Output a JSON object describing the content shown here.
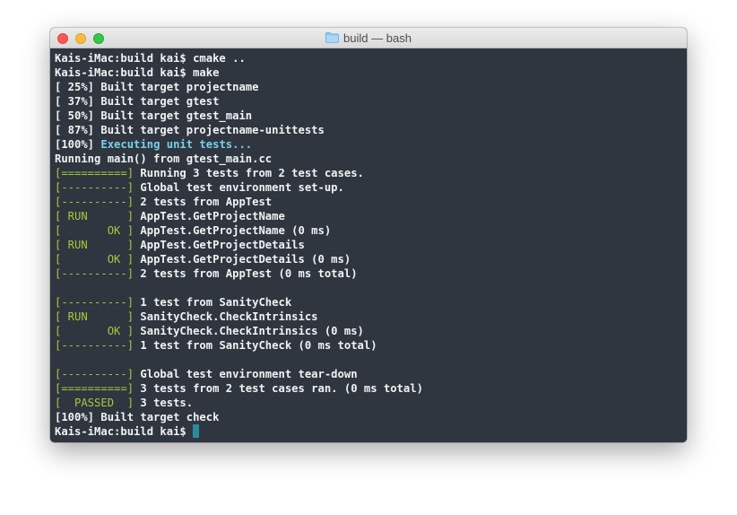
{
  "window": {
    "title": "build — bash",
    "folder_icon": "folder-icon",
    "colors": {
      "terminal_bg": "#2f3640",
      "text": "#f2f2f2",
      "gtest_green": "#a6c93b",
      "cyan": "#7ad0ea",
      "cursor": "#2a8c9a"
    }
  },
  "terminal": {
    "lines": [
      {
        "tag": "",
        "text": "Kais-iMac:build kai$ cmake .."
      },
      {
        "tag": "",
        "text": "Kais-iMac:build kai$ make"
      },
      {
        "tag": "",
        "text": "[ 25%] Built target projectname"
      },
      {
        "tag": "",
        "text": "[ 37%] Built target gtest"
      },
      {
        "tag": "",
        "text": "[ 50%] Built target gtest_main"
      },
      {
        "tag": "",
        "text": "[ 87%] Built target projectname-unittests"
      },
      {
        "tag": "",
        "text": "[100%] ",
        "highlight": "Executing unit tests..."
      },
      {
        "tag": "",
        "text": "Running main() from gtest_main.cc"
      },
      {
        "tag": "[==========]",
        "text": " Running 3 tests from 2 test cases."
      },
      {
        "tag": "[----------]",
        "text": " Global test environment set-up."
      },
      {
        "tag": "[----------]",
        "text": " 2 tests from AppTest"
      },
      {
        "tag": "[ RUN      ]",
        "text": " AppTest.GetProjectName"
      },
      {
        "tag": "[       OK ]",
        "text": " AppTest.GetProjectName (0 ms)"
      },
      {
        "tag": "[ RUN      ]",
        "text": " AppTest.GetProjectDetails"
      },
      {
        "tag": "[       OK ]",
        "text": " AppTest.GetProjectDetails (0 ms)"
      },
      {
        "tag": "[----------]",
        "text": " 2 tests from AppTest (0 ms total)"
      },
      {
        "tag": "",
        "text": ""
      },
      {
        "tag": "[----------]",
        "text": " 1 test from SanityCheck"
      },
      {
        "tag": "[ RUN      ]",
        "text": " SanityCheck.CheckIntrinsics"
      },
      {
        "tag": "[       OK ]",
        "text": " SanityCheck.CheckIntrinsics (0 ms)"
      },
      {
        "tag": "[----------]",
        "text": " 1 test from SanityCheck (0 ms total)"
      },
      {
        "tag": "",
        "text": ""
      },
      {
        "tag": "[----------]",
        "text": " Global test environment tear-down"
      },
      {
        "tag": "[==========]",
        "text": " 3 tests from 2 test cases ran. (0 ms total)"
      },
      {
        "tag": "[  PASSED  ]",
        "text": " 3 tests."
      },
      {
        "tag": "",
        "text": "[100%] Built target check"
      }
    ],
    "prompt": "Kais-iMac:build kai$ "
  }
}
